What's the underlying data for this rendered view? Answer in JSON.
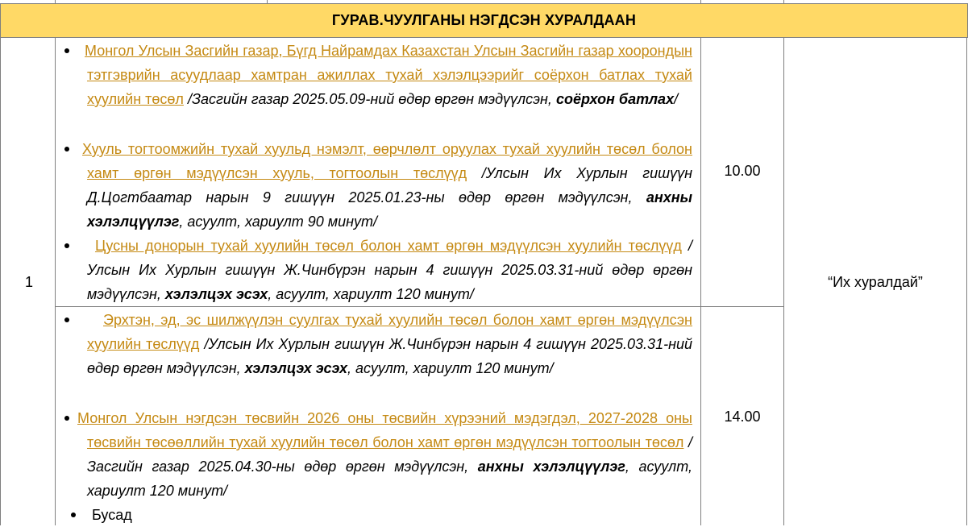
{
  "section_title": "ГУРАВ.ЧУУЛГАНЫ НЭГДСЭН ХУРАЛДААН",
  "row_number": "1",
  "location": "“Их хуралдай”",
  "colors": {
    "header_bg": "#ffd966",
    "link": "#c58a14",
    "border": "#7f7f7f"
  },
  "block1": {
    "time": "10.00",
    "items": [
      {
        "link": "Монгол Улсын Засгийн газар, Бүгд Найрамдах Казахстан Улсын Засгийн газар хоорондын тэтгэврийн асуудлаар хамтран ажиллах тухай хэлэлцээрийг соёрхон батлах тухай хуулийн төсөл",
        "note1": " /Засгийн газар 2025.05.09-ний өдөр өргөн мэдүүлсэн, ",
        "bold": "соёрхон батлах",
        "note2": "/"
      },
      {
        "link": "Хууль тогтоомжийн тухай хуульд нэмэлт, өөрчлөлт оруулах тухай хуулийн төсөл болон хамт өргөн мэдүүлсэн хууль, тогтоолын төслүүд",
        "note1": " /Улсын Их Хурлын гишүүн Д.Цогтбаатар нарын 9 гишүүн 2025.01.23-ны өдөр өргөн мэдүүлсэн, ",
        "bold": "анхны хэлэлцүүлэг",
        "note2": ", асуулт, хариулт 90 минут/"
      },
      {
        "link": "Цусны донорын тухай хуулийн төсөл болон хамт өргөн мэдүүлсэн хуулийн төслүүд",
        "note1": " /Улсын Их Хурлын гишүүн Ж.Чинбүрэн нарын 4 гишүүн 2025.03.31-ний өдөр өргөн мэдүүлсэн, ",
        "bold": "хэлэлцэх эсэх",
        "note2": ", асуулт, хариулт 120 минут/"
      }
    ]
  },
  "block2": {
    "time": "14.00",
    "items": [
      {
        "link": "Эрхтэн, эд, эс шилжүүлэн суулгах тухай хуулийн төсөл болон хамт өргөн мэдүүлсэн хуулийн төслүүд",
        "note1": " /Улсын Их Хурлын гишүүн Ж.Чинбүрэн нарын 4 гишүүн 2025.03.31-ний өдөр өргөн мэдүүлсэн, ",
        "bold": "хэлэлцэх эсэх",
        "note2": ", асуулт, хариулт 120 минут/"
      },
      {
        "link": "Монгол Улсын нэгдсэн төсвийн 2026 оны төсвийн хүрээний мэдэгдэл, 2027-2028 оны төсвийн төсөөллийн тухай хуулийн төсөл болон хамт өргөн мэдүүлсэн тогтоолын төсөл",
        "note1": " /Засгийн газар 2025.04.30-ны өдөр өргөн мэдүүлсэн, ",
        "bold": "анхны хэлэлцүүлэг",
        "note2": ", асуулт, хариулт 120 минут/"
      }
    ],
    "other_label": "Бусад"
  }
}
